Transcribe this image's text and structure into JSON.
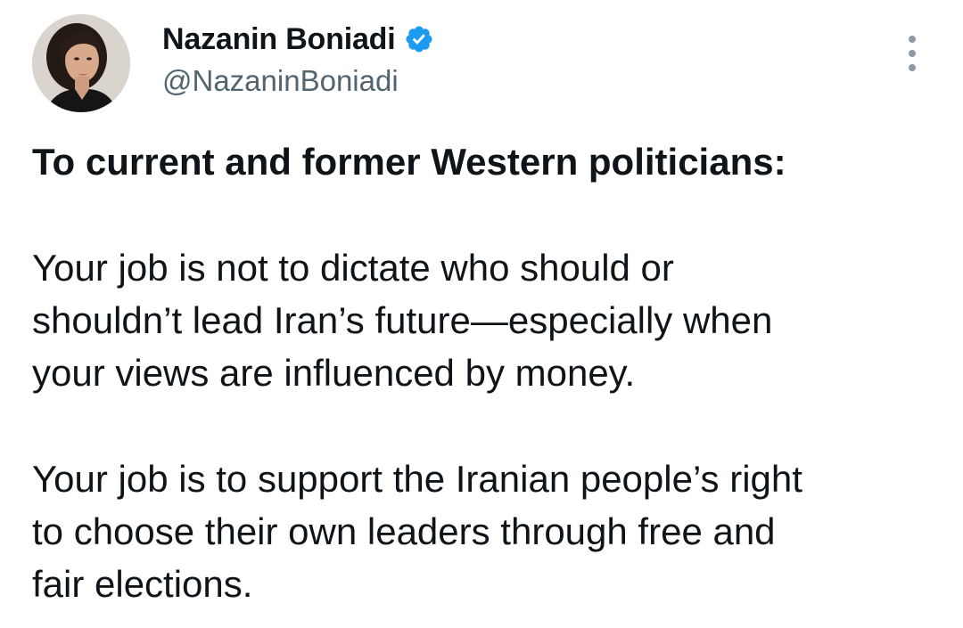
{
  "author": {
    "display_name": "Nazanin Boniadi",
    "handle": "@NazaninBoniadi",
    "verified_icon": "verified-badge-icon",
    "verified_color": "#1d9bf0"
  },
  "menu": {
    "icon": "more-options-icon"
  },
  "tweet": {
    "heading": "To current and former Western politicians:",
    "paragraph1": [
      "Your job is not to dictate who should or",
      "shouldn’t lead Iran’s future—especially when",
      "your views are influenced by money."
    ],
    "paragraph2": [
      "Your job is to support the Iranian people’s right",
      "to choose their own leaders through free and",
      "fair elections."
    ]
  }
}
